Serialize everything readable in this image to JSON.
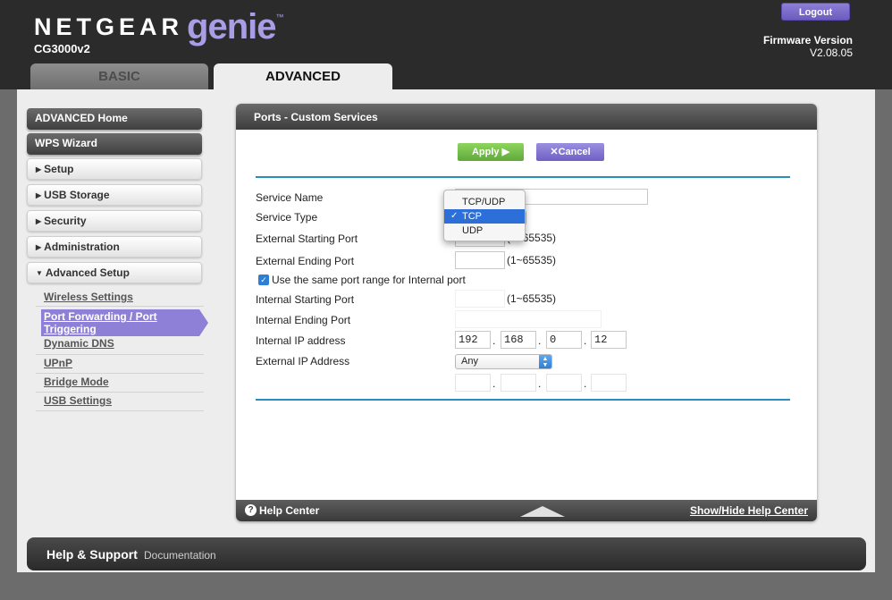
{
  "header": {
    "brand_netgear": "NETGEAR",
    "brand_genie": "genie",
    "brand_tm": "™",
    "model": "CG3000v2",
    "logout_label": "Logout",
    "fw_label": "Firmware Version",
    "fw_version": "V2.08.05"
  },
  "tabs": [
    {
      "label": "BASIC",
      "active": false
    },
    {
      "label": "ADVANCED",
      "active": true
    }
  ],
  "sidebar": {
    "advanced_home": "ADVANCED Home",
    "wps_wizard": "WPS Wizard",
    "sections": [
      {
        "label": "Setup",
        "arrow": "▶"
      },
      {
        "label": "USB Storage",
        "arrow": "▶"
      },
      {
        "label": "Security",
        "arrow": "▶"
      },
      {
        "label": "Administration",
        "arrow": "▶"
      },
      {
        "label": "Advanced Setup",
        "arrow": "▼"
      }
    ],
    "sub_items": [
      {
        "label": "Wireless Settings"
      },
      {
        "label": "Port Forwarding / Port Triggering",
        "active": true
      },
      {
        "label": "Dynamic DNS"
      },
      {
        "label": "UPnP"
      },
      {
        "label": "Bridge Mode"
      },
      {
        "label": "USB Settings"
      }
    ]
  },
  "panel": {
    "title": "Ports - Custom Services",
    "apply_label": "Apply ▶",
    "cancel_label": "Cancel",
    "fields": {
      "service_name": "Service Name",
      "service_type": "Service Type",
      "ext_start": "External Starting Port",
      "ext_end": "External Ending Port",
      "same_range": "Use the same port range for Internal port",
      "int_start": "Internal Starting Port",
      "int_end": "Internal Ending Port",
      "int_ip": "Internal IP address",
      "ext_ip": "External IP Address"
    },
    "range_hint": "(1~65535)",
    "ext_start_hint": "(1~65535)",
    "internal_ip": [
      "192",
      "168",
      "0",
      "12"
    ],
    "ext_ip_select": "Any",
    "dot": ".",
    "same_range_checked": true,
    "help_center": "Help Center",
    "show_hide": "Show/Hide Help Center"
  },
  "dropdown": {
    "options": [
      {
        "label": "TCP/UDP",
        "selected": false
      },
      {
        "label": "TCP",
        "selected": true
      },
      {
        "label": "UDP",
        "selected": false
      }
    ],
    "check": "✓"
  },
  "help_bar": {
    "title": "Help & Support",
    "documentation": "Documentation"
  },
  "colors": {
    "accent_purple": "#8d80d6",
    "apply_green": "#6fbf45",
    "divider_blue": "#2a8cbf",
    "selected_blue": "#2d6fd8"
  }
}
